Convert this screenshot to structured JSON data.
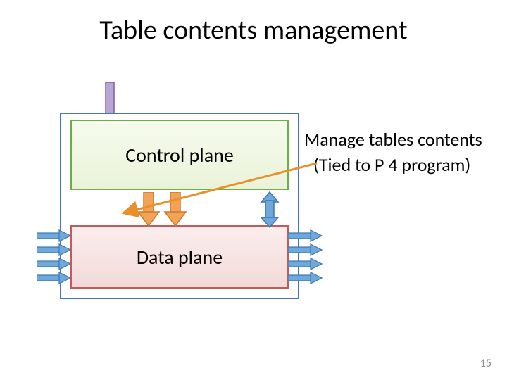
{
  "title": "Table contents management",
  "boxes": {
    "control_plane": "Control plane",
    "data_plane": "Data plane"
  },
  "annotations": {
    "line1": "Manage tables contents",
    "line2": "(Tied to P 4 program)"
  },
  "page_number": "15"
}
